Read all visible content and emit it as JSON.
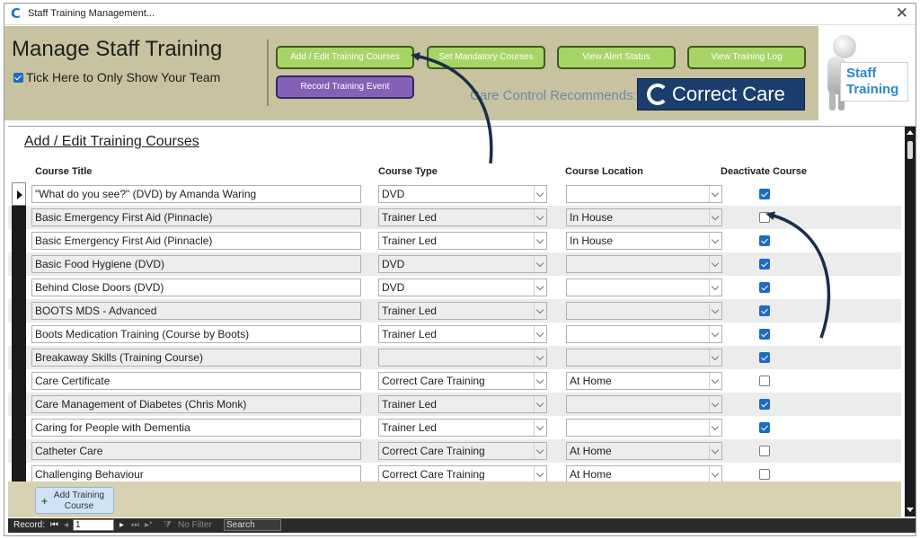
{
  "window": {
    "title": "Staff Training Management...",
    "app_icon": "C",
    "close_glyph": "✕"
  },
  "header": {
    "title": "Manage Staff Training",
    "team_label": "Tick Here to Only Show Your Team",
    "team_checked": true,
    "buttons": {
      "add_edit": "Add / Edit Training Courses",
      "mandatory": "Set Mandatory Courses",
      "alert": "View Alert Status",
      "log": "View Training Log",
      "record": "Record Training Event"
    },
    "recommends": "Care Control Recommends:",
    "logo_text": "Correct Care",
    "side_sign_line1": "Staff",
    "side_sign_line2": "Training"
  },
  "section": {
    "title": "Add / Edit Training Courses",
    "columns": {
      "title": "Course Title",
      "type": "Course Type",
      "location": "Course Location",
      "deactivate": "Deactivate Course"
    }
  },
  "rows": [
    {
      "title": "\"What do you see?\" (DVD) by Amanda Waring",
      "type": "DVD",
      "location": "",
      "deactivated": true
    },
    {
      "title": "Basic Emergency First Aid (Pinnacle)",
      "type": "Trainer Led",
      "location": "In House",
      "deactivated": false
    },
    {
      "title": "Basic Emergency First Aid (Pinnacle)",
      "type": "Trainer Led",
      "location": "In House",
      "deactivated": true
    },
    {
      "title": "Basic Food Hygiene (DVD)",
      "type": "DVD",
      "location": "",
      "deactivated": true
    },
    {
      "title": "Behind Close Doors (DVD)",
      "type": "DVD",
      "location": "",
      "deactivated": true
    },
    {
      "title": "BOOTS MDS - Advanced",
      "type": "Trainer Led",
      "location": "",
      "deactivated": true
    },
    {
      "title": "Boots Medication Training (Course by Boots)",
      "type": "Trainer Led",
      "location": "",
      "deactivated": true
    },
    {
      "title": "Breakaway Skills (Training Course)",
      "type": "",
      "location": "",
      "deactivated": true
    },
    {
      "title": "Care Certificate",
      "type": "Correct Care Training",
      "location": "At Home",
      "deactivated": false
    },
    {
      "title": "Care Management of Diabetes (Chris Monk)",
      "type": "Trainer Led",
      "location": "",
      "deactivated": true
    },
    {
      "title": "Caring for People with Dementia",
      "type": "Trainer Led",
      "location": "",
      "deactivated": true
    },
    {
      "title": "Catheter Care",
      "type": "Correct Care Training",
      "location": "At Home",
      "deactivated": false
    },
    {
      "title": "Challenging Behaviour",
      "type": "Correct Care Training",
      "location": "At Home",
      "deactivated": false
    }
  ],
  "footer": {
    "add_button_line1": "Add Training",
    "add_button_line2": "Course"
  },
  "navbar": {
    "record_label": "Record:",
    "record_value": "1",
    "filter_label": "No Filter",
    "search_label": "Search"
  },
  "colors": {
    "header_bg": "#c8c2a0",
    "green_button": "#a7d565",
    "purple_button": "#8361b6",
    "logo_bg": "#1b3e6e",
    "checkbox_blue": "#1c6bc4",
    "arrow": "#1a2d4a"
  }
}
